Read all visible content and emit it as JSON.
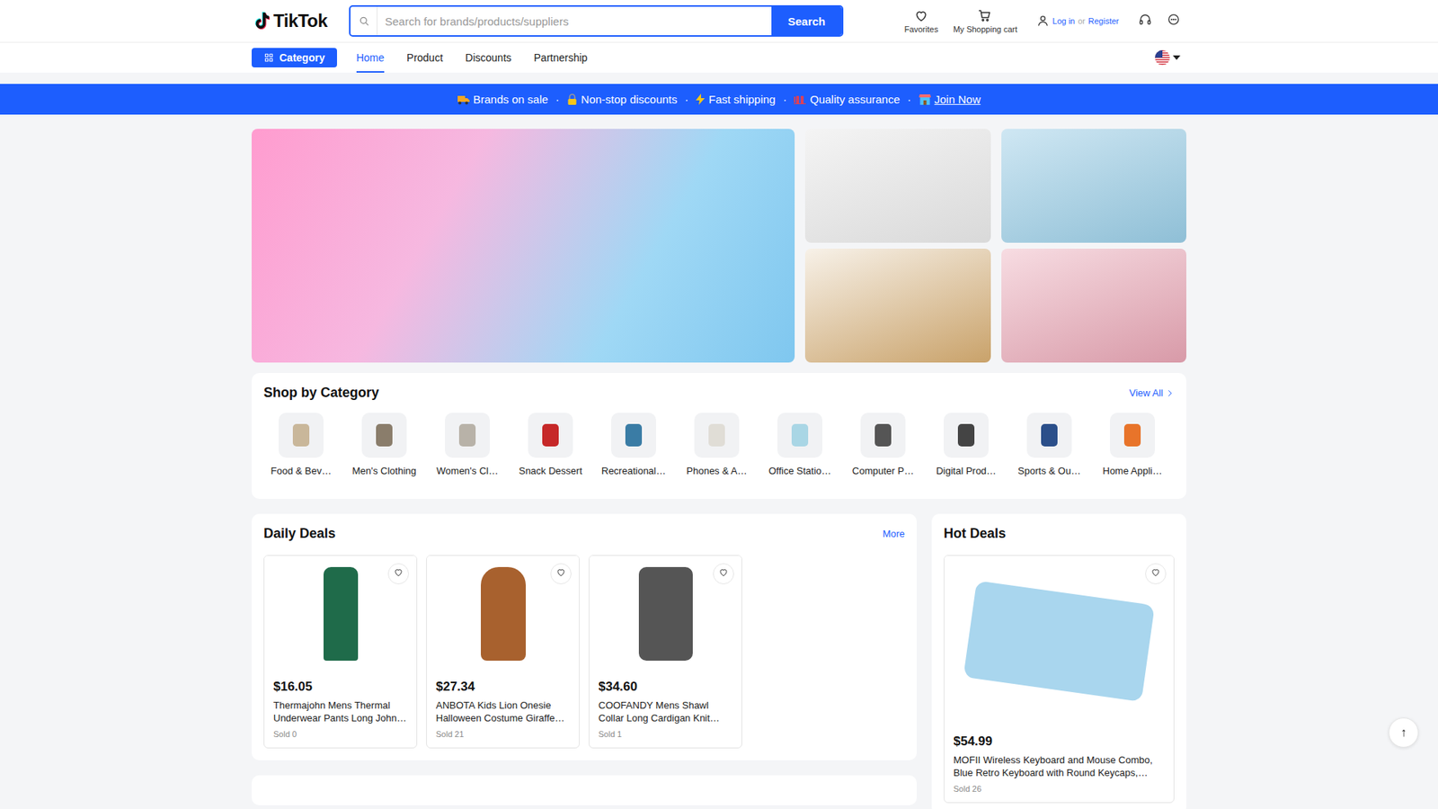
{
  "header": {
    "logo": "TikTok",
    "search": {
      "placeholder": "Search for brands/products/suppliers",
      "button": "Search"
    },
    "favorites": "Favorites",
    "cart": "My Shopping cart",
    "login": "Log in",
    "or": "or",
    "register": "Register"
  },
  "nav": {
    "category": "Category",
    "tabs": [
      {
        "label": "Home",
        "selected": true
      },
      {
        "label": "Product",
        "selected": false
      },
      {
        "label": "Discounts",
        "selected": false
      },
      {
        "label": "Partnership",
        "selected": false
      }
    ]
  },
  "promo_bar": {
    "separator": "·",
    "items": [
      {
        "label": "Brands on sale",
        "link": false
      },
      {
        "label": "Non-stop discounts",
        "link": false
      },
      {
        "label": "Fast shipping",
        "link": false
      },
      {
        "label": "Quality assurance",
        "link": false
      },
      {
        "label": "Join Now",
        "link": true
      }
    ]
  },
  "categories": {
    "title": "Shop by Category",
    "view_all": "View All",
    "items": [
      {
        "label": "Food & Bev…"
      },
      {
        "label": "Men's Clothing"
      },
      {
        "label": "Women's Cl…"
      },
      {
        "label": "Snack Dessert"
      },
      {
        "label": "Recreational…"
      },
      {
        "label": "Phones & A…"
      },
      {
        "label": "Office Statio…"
      },
      {
        "label": "Computer P…"
      },
      {
        "label": "Digital Prod…"
      },
      {
        "label": "Sports & Ou…"
      },
      {
        "label": "Home Appli…"
      }
    ]
  },
  "daily_deals": {
    "title": "Daily Deals",
    "more": "More",
    "products": [
      {
        "price": "$16.05",
        "title": "Thermajohn Mens Thermal Underwear Pants Long John…",
        "sold": "Sold 0",
        "favorite": false
      },
      {
        "price": "$27.34",
        "title": "ANBOTA Kids Lion Onesie Halloween Costume Giraffe…",
        "sold": "Sold 21",
        "favorite": false
      },
      {
        "price": "$34.60",
        "title": "COOFANDY Mens Shawl Collar Long Cardigan Knit…",
        "sold": "Sold 1",
        "favorite": false
      }
    ]
  },
  "hot_deals": {
    "title": "Hot Deals",
    "products": [
      {
        "price": "$54.99",
        "title": "MOFII Wireless Keyboard and Mouse Combo, Blue Retro Keyboard with Round Keycaps,…",
        "sold": "Sold 26",
        "favorite": false
      }
    ]
  },
  "scroll_top": "↑"
}
